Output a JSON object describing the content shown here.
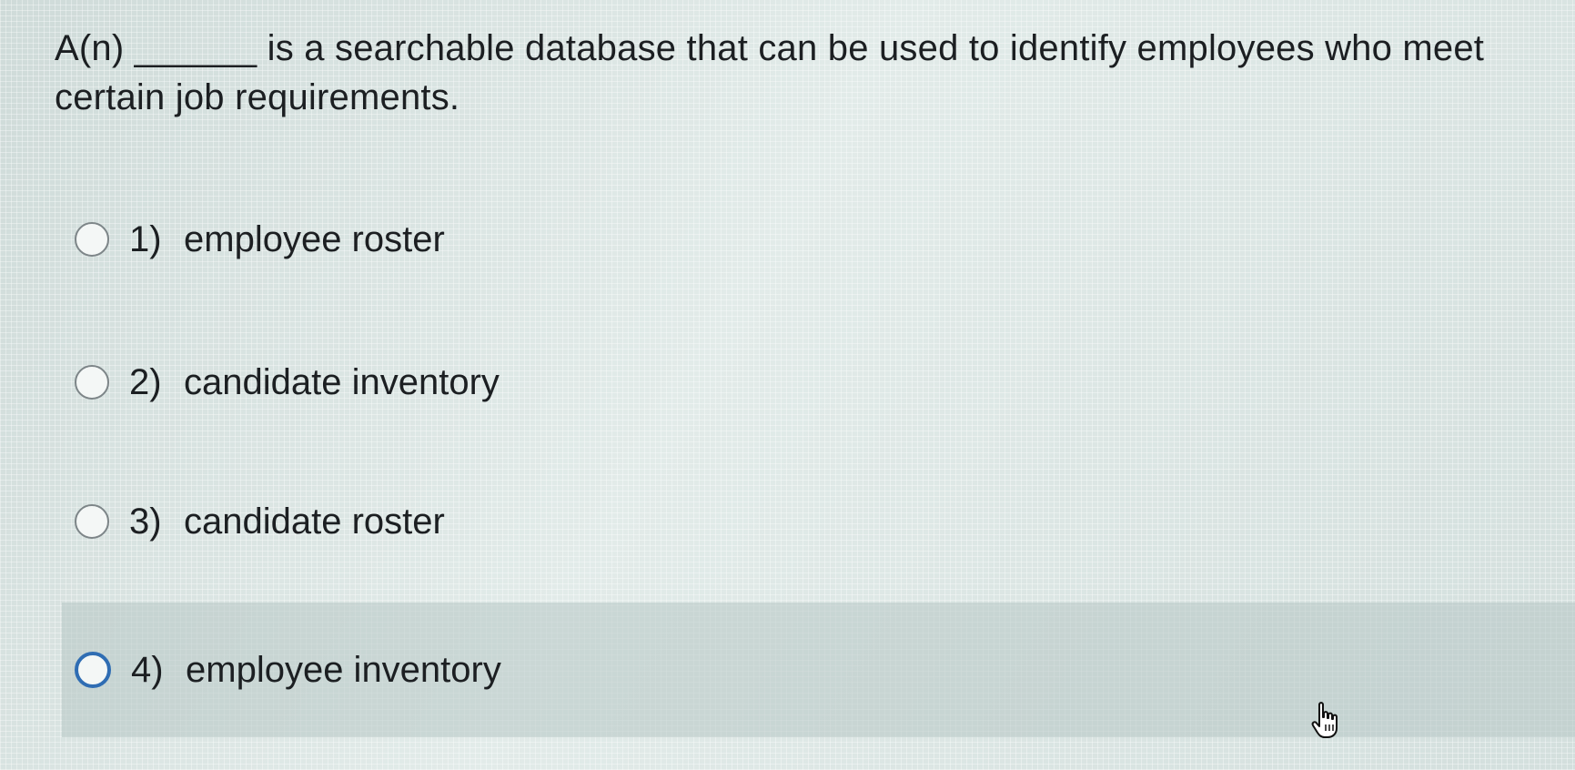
{
  "question": {
    "text": "A(n) ______ is a searchable database that can be used to identify employees who meet certain job requirements."
  },
  "options": [
    {
      "number": "1)",
      "label": "employee roster",
      "selected": false
    },
    {
      "number": "2)",
      "label": "candidate inventory",
      "selected": false
    },
    {
      "number": "3)",
      "label": "candidate roster",
      "selected": false
    },
    {
      "number": "4)",
      "label": "employee inventory",
      "selected": false,
      "hovered": true
    }
  ],
  "colors": {
    "background": "#d9e4e2",
    "text": "#1c1f22",
    "radio_focus": "#2f6db3",
    "hover_band": "#b6c6c4"
  },
  "icons": {
    "pointer": "hand-pointer-cursor-icon"
  }
}
